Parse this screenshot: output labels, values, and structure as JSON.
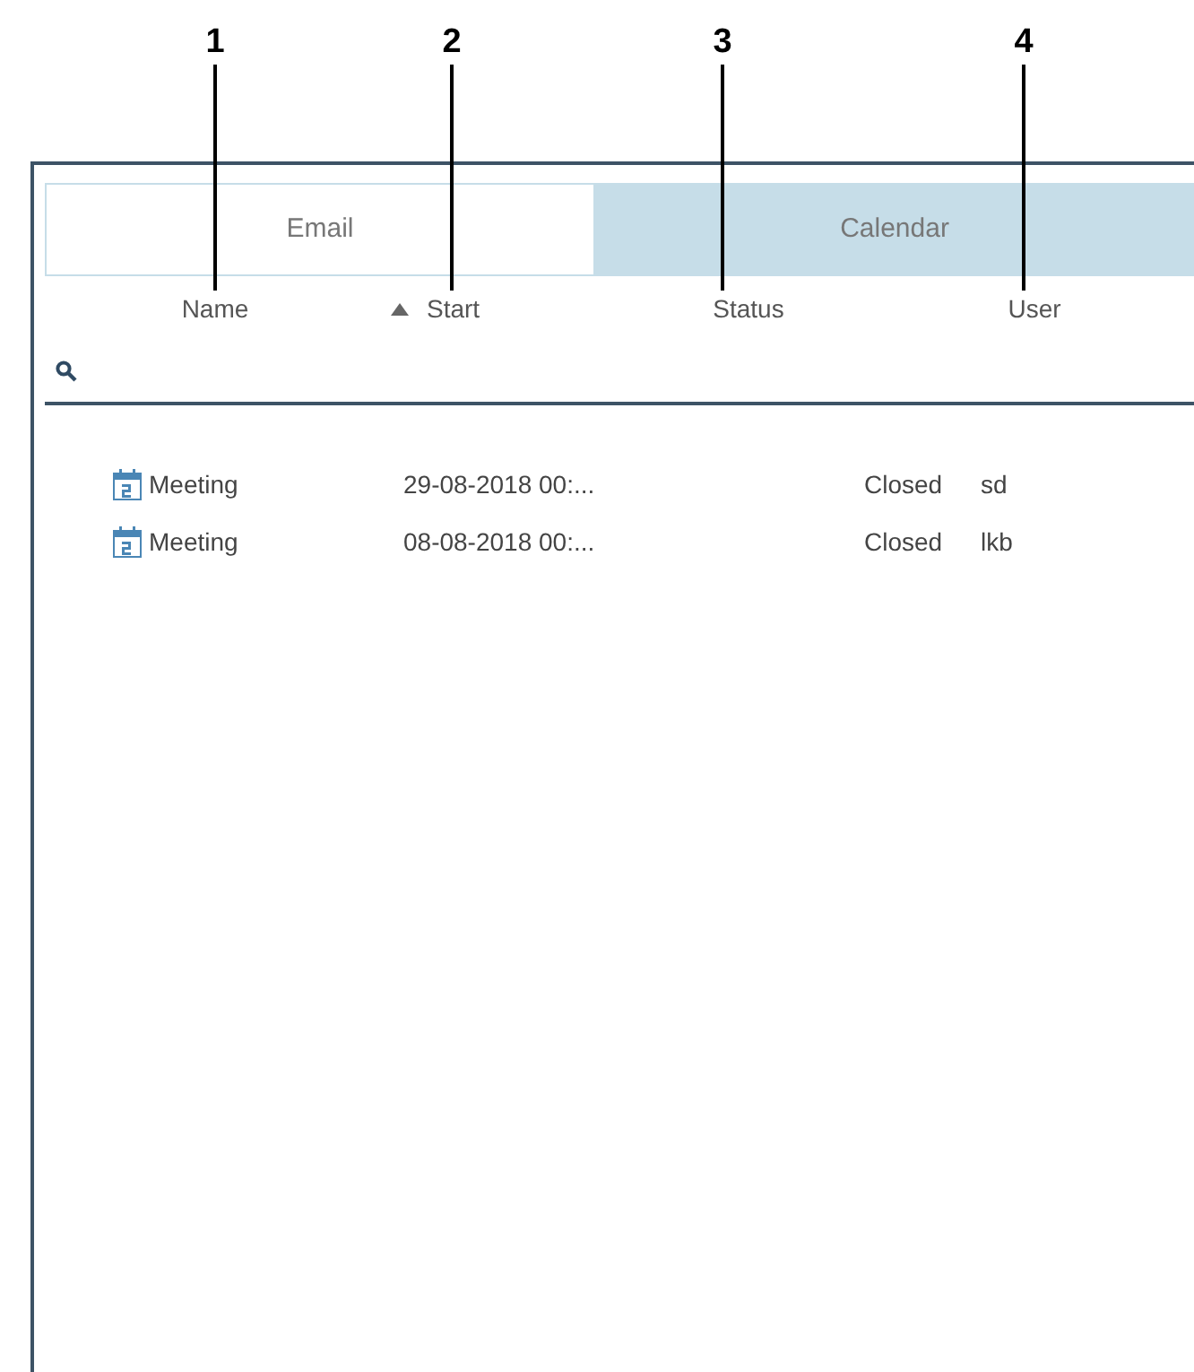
{
  "callouts": [
    {
      "label": "1"
    },
    {
      "label": "2"
    },
    {
      "label": "3"
    },
    {
      "label": "4"
    }
  ],
  "tabs": [
    {
      "label": "Email",
      "selected": false
    },
    {
      "label": "Calendar",
      "selected": true
    }
  ],
  "columns": [
    {
      "label": "Name",
      "sorted": false
    },
    {
      "label": "Start",
      "sorted": true
    },
    {
      "label": "Status",
      "sorted": false
    },
    {
      "label": "User",
      "sorted": false
    }
  ],
  "rows": [
    {
      "name": "Meeting",
      "start": "29-08-2018 00:...",
      "status": "Closed",
      "user": "sd"
    },
    {
      "name": "Meeting",
      "start": "08-08-2018 00:...",
      "status": "Closed",
      "user": "lkb"
    }
  ]
}
